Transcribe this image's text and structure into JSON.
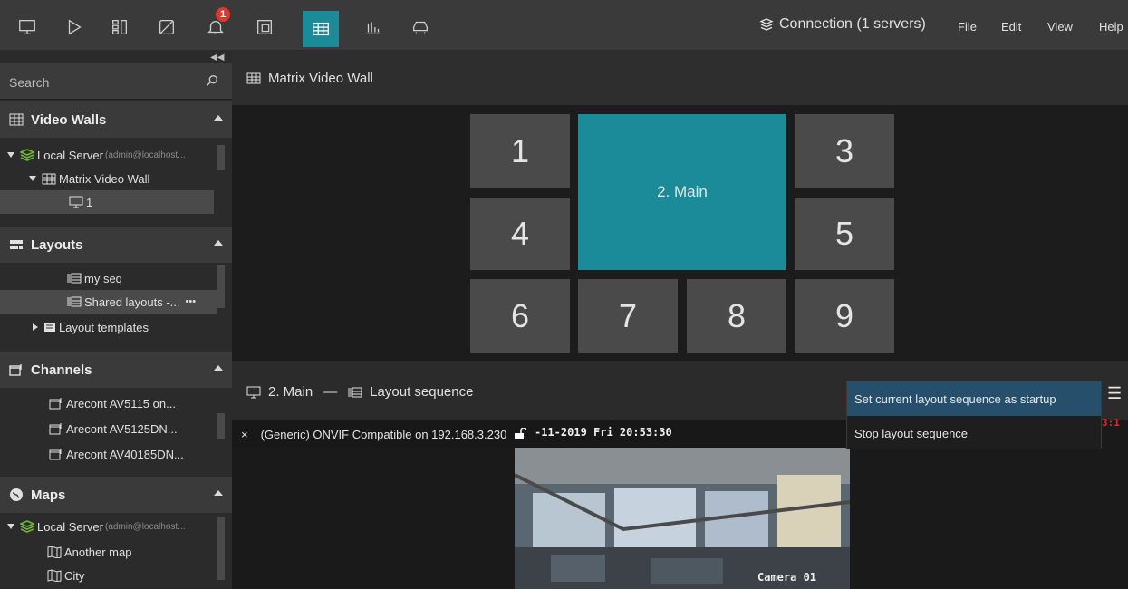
{
  "topbar": {
    "notification_count": "1",
    "connection_label": "Connection (1 servers)",
    "menus": [
      "File",
      "Edit",
      "View",
      "Help"
    ],
    "icons": [
      "monitor-icon",
      "play-icon",
      "layout-grid-icon",
      "disabled-camera-icon",
      "bell-icon",
      "copy-layout-icon",
      "video-wall-icon",
      "statistics-icon",
      "car-icon"
    ],
    "active_icon": "video-wall-icon",
    "accent_color": "#1b8a99"
  },
  "sidebar": {
    "search_placeholder": "Search",
    "video_walls": {
      "title": "Video Walls",
      "server": "Local Server",
      "server_user": "(admin@localhost...",
      "wall": "Matrix Video Wall",
      "monitor": "1"
    },
    "layouts": {
      "title": "Layouts",
      "items": [
        "my seq",
        "Shared layouts -...",
        "Layout templates"
      ],
      "more": "•••"
    },
    "channels": {
      "title": "Channels",
      "items": [
        "Arecont AV5115 on...",
        "Arecont AV5125DN...",
        "Arecont AV40185DN..."
      ]
    },
    "maps": {
      "title": "Maps",
      "server": "Local Server",
      "server_user": "(admin@localhost...",
      "items": [
        "Another map",
        "City"
      ]
    }
  },
  "main": {
    "title": "Matrix Video Wall",
    "cells": [
      "1",
      "2. Main",
      "3",
      "4",
      "5",
      "6",
      "7",
      "8",
      "9"
    ],
    "monitor_label": "2. Main",
    "separator": "—",
    "sequence_label": "Layout sequence",
    "camera_title": "(Generic) ONVIF Compatible on 192.168.3.230",
    "close_symbol": "×",
    "osd_datetime": "-11-2019 Fri 20:53:30",
    "osd_red": "3:1",
    "camera_overlay": "Camera 01"
  },
  "context_menu": {
    "items": [
      "Set current layout sequence as startup",
      "Stop layout sequence"
    ],
    "highlight_color": "#264f6b"
  }
}
